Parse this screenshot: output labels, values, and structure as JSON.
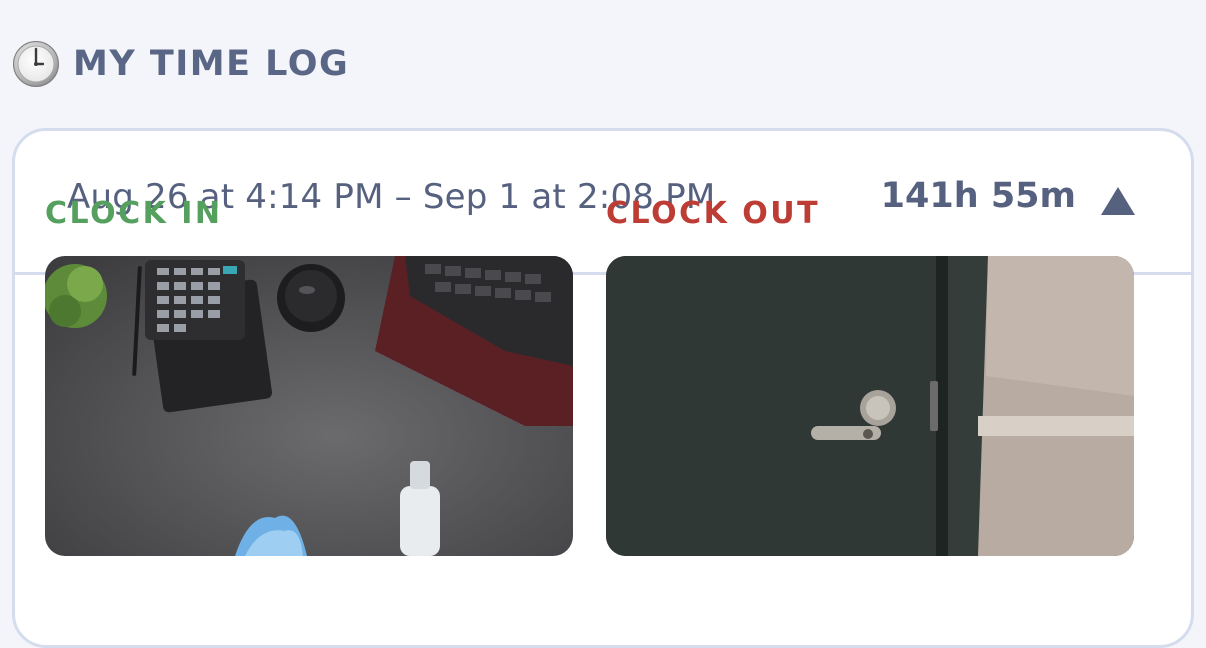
{
  "header": {
    "title": "MY TIME LOG",
    "icon": "clock-icon"
  },
  "entry": {
    "range": "Aug 26 at 4:14 PM – Sep 1 at 2:08 PM",
    "duration": "141h 55m",
    "toggle_icon": "caret-up-icon",
    "clock_in": {
      "label": "CLOCK IN",
      "photo": "desk-photo"
    },
    "clock_out": {
      "label": "CLOCK OUT",
      "photo": "door-photo"
    }
  },
  "colors": {
    "background": "#f3f5fa",
    "text": "#56617f",
    "border": "#d4dcee",
    "clock_in": "#55a05e",
    "clock_out": "#bd3c33"
  }
}
